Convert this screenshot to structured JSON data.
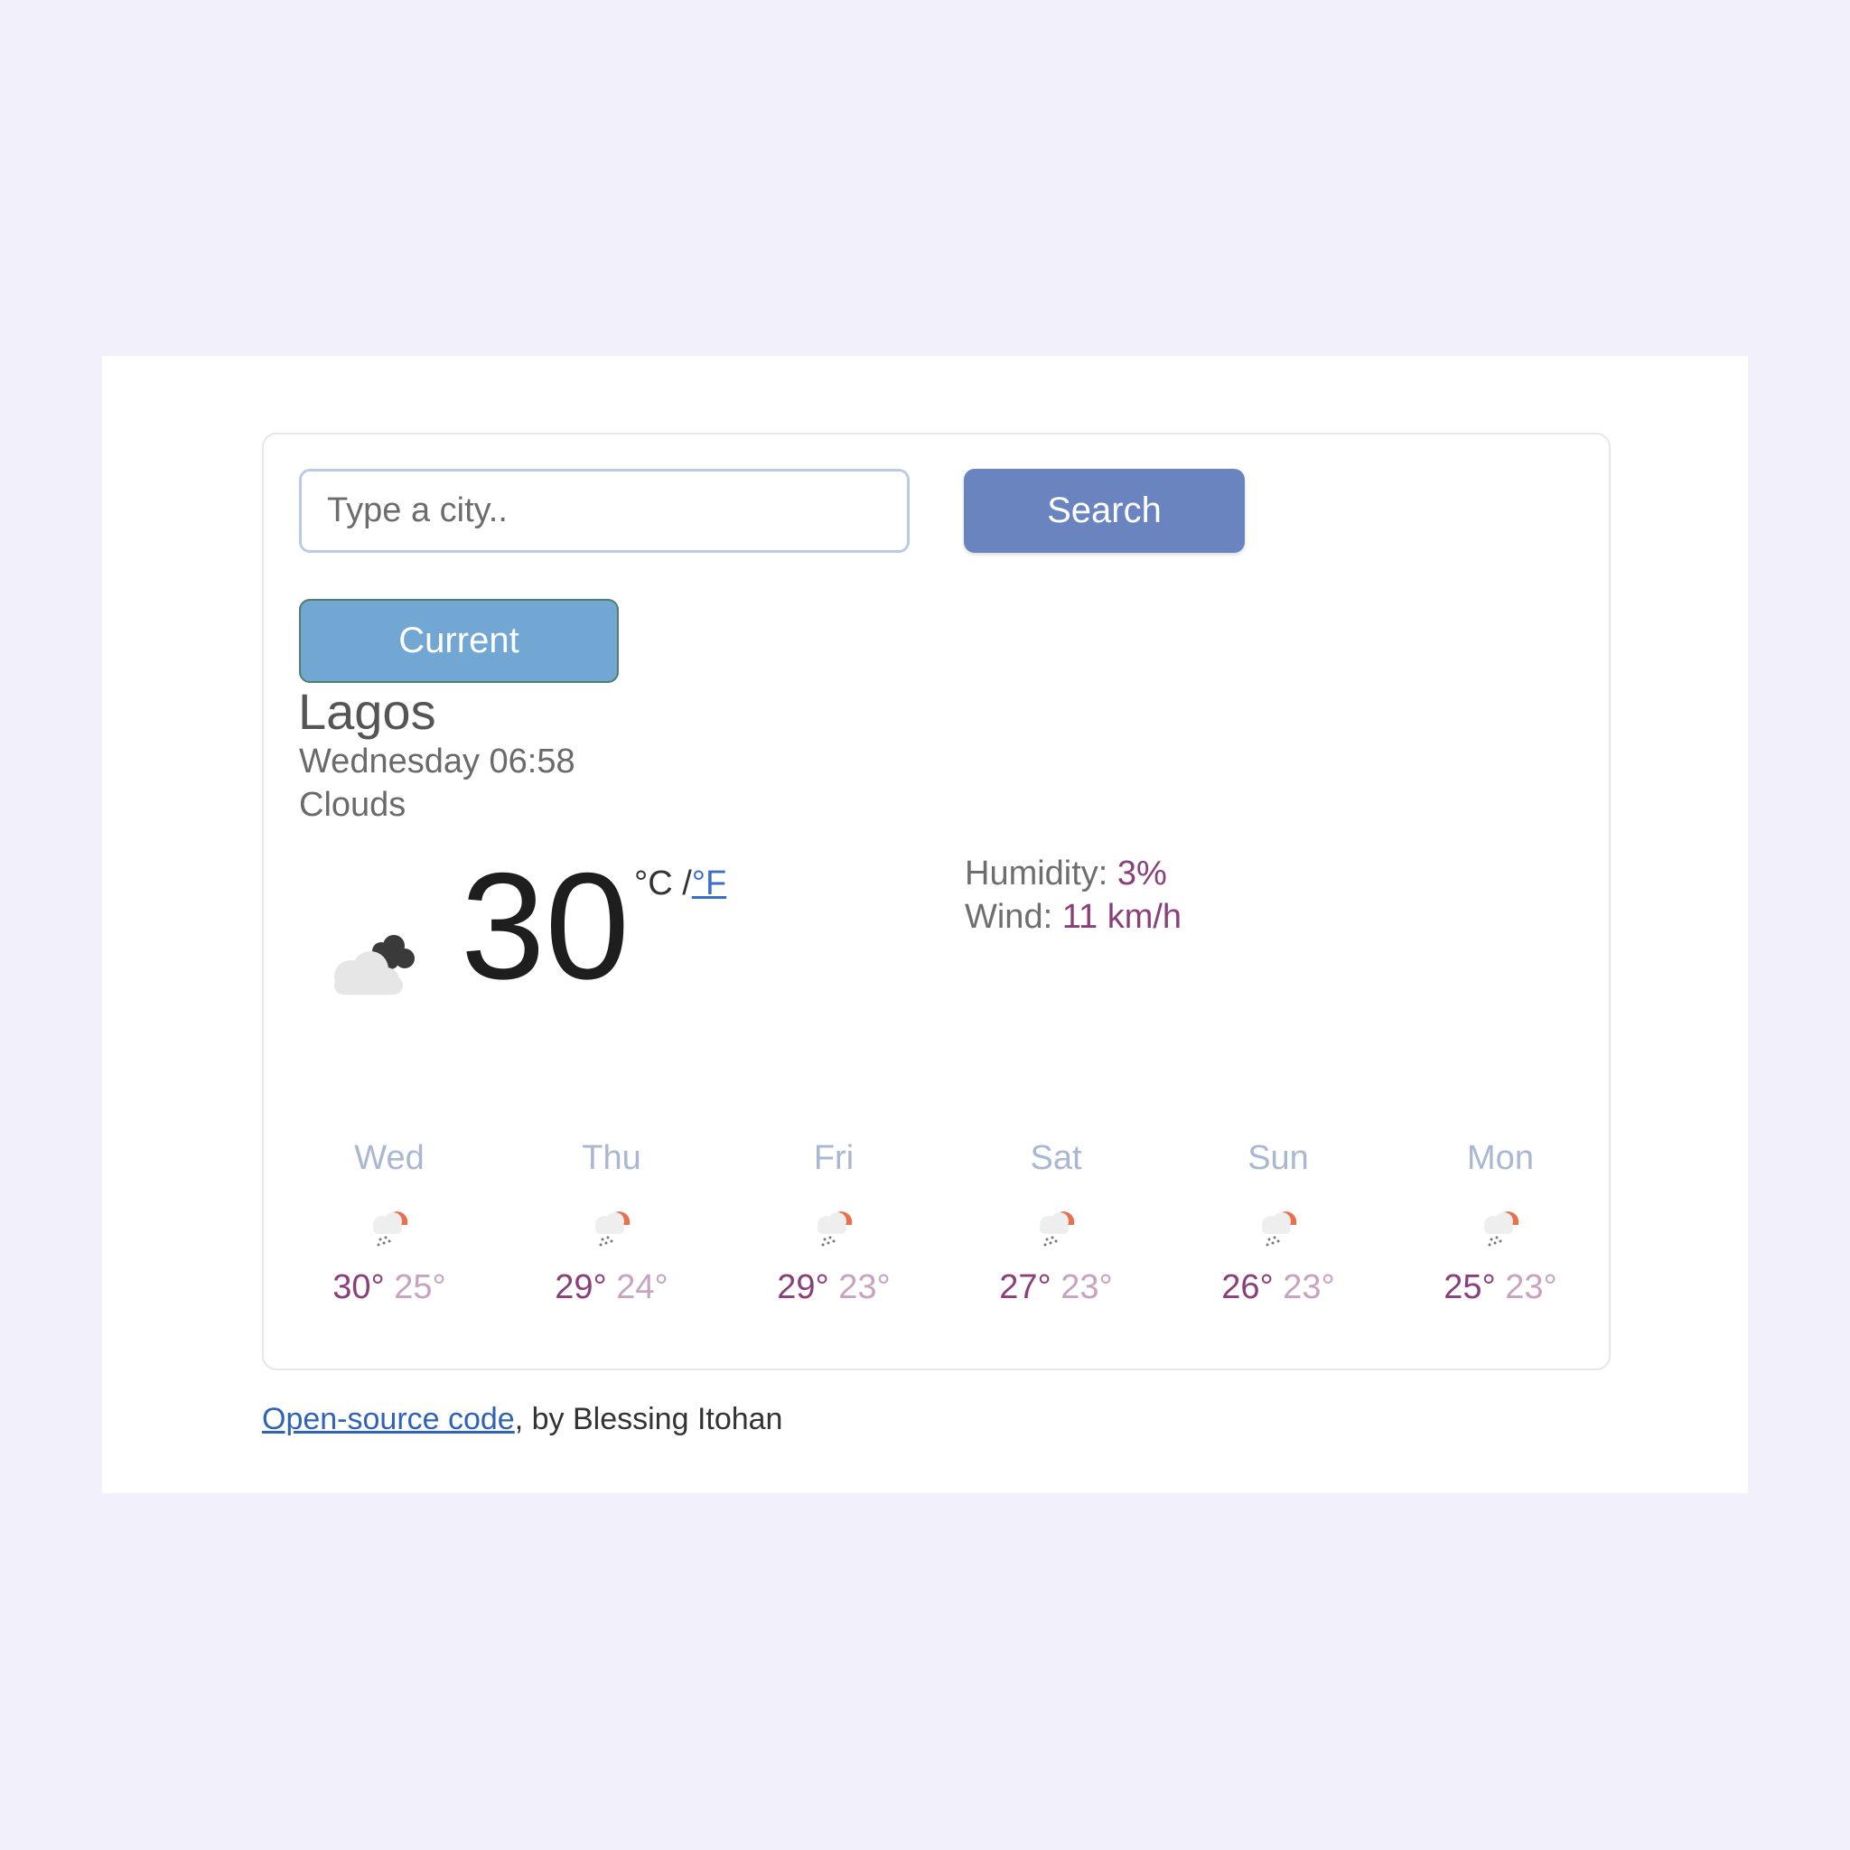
{
  "search": {
    "placeholder": "Type a city..",
    "button_label": "Search"
  },
  "current_button_label": "Current",
  "location": {
    "city": "Lagos",
    "datetime": "Wednesday 06:58",
    "description": "Clouds"
  },
  "current": {
    "temperature": "30",
    "unit_c": "°C",
    "unit_sep": " /",
    "unit_f": "°F",
    "icon": "cloudy-icon",
    "humidity_label": "Humidity: ",
    "humidity_value": "3%",
    "wind_label": "Wind: ",
    "wind_value": "11 km/h"
  },
  "forecast": [
    {
      "day": "Wed",
      "max": "30°",
      "min": "25°",
      "icon": "rain-sun-icon"
    },
    {
      "day": "Thu",
      "max": "29°",
      "min": "24°",
      "icon": "rain-sun-icon"
    },
    {
      "day": "Fri",
      "max": "29°",
      "min": "23°",
      "icon": "rain-sun-icon"
    },
    {
      "day": "Sat",
      "max": "27°",
      "min": "23°",
      "icon": "rain-sun-icon"
    },
    {
      "day": "Sun",
      "max": "26°",
      "min": "23°",
      "icon": "rain-sun-icon"
    },
    {
      "day": "Mon",
      "max": "25°",
      "min": "23°",
      "icon": "rain-sun-icon"
    }
  ],
  "footer": {
    "link_text": "Open-source code",
    "suffix": ", by Blessing Itohan"
  },
  "colors": {
    "search_button": "#6a84c0",
    "current_button": "#72a6d3",
    "accent": "#8b3f7a",
    "background": "#f2f0fb"
  }
}
